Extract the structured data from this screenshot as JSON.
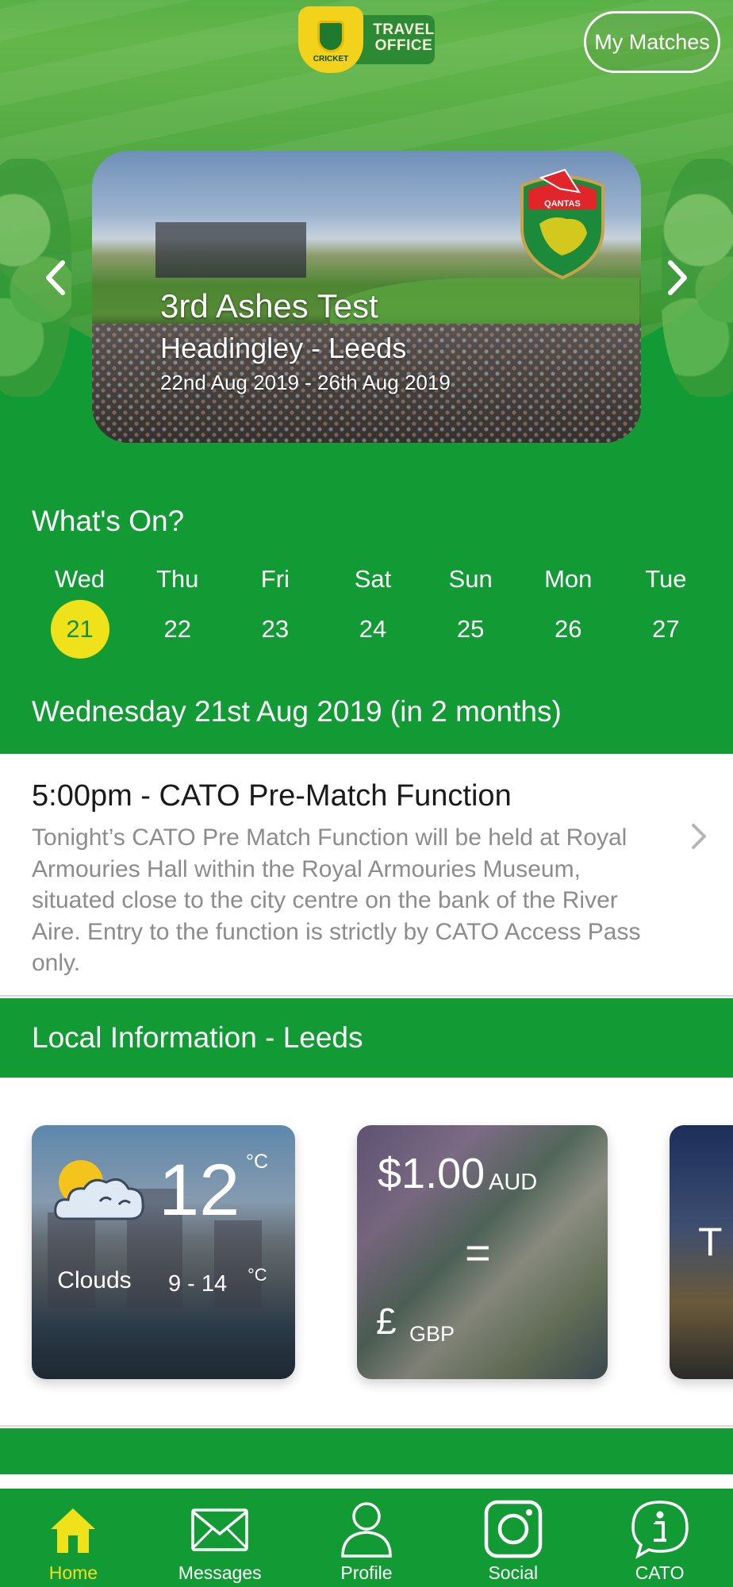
{
  "header": {
    "logo_line1": "TRAVEL",
    "logo_line2": "OFFICE",
    "logo_shield_text": "CRICKET",
    "my_matches_label": "My Matches"
  },
  "featured_match": {
    "title": "3rd Ashes Test",
    "venue": "Headingley - Leeds",
    "dates": "22nd Aug 2019 - 26th Aug 2019",
    "sponsor_badge": "QANTAS"
  },
  "whats_on": {
    "title": "What's On?",
    "days": [
      {
        "name": "Wed",
        "num": "21"
      },
      {
        "name": "Thu",
        "num": "22"
      },
      {
        "name": "Fri",
        "num": "23"
      },
      {
        "name": "Sat",
        "num": "24"
      },
      {
        "name": "Sun",
        "num": "25"
      },
      {
        "name": "Mon",
        "num": "26"
      },
      {
        "name": "Tue",
        "num": "27"
      }
    ],
    "selected_index": 0,
    "date_heading": "Wednesday 21st Aug 2019 (in 2 months)"
  },
  "event": {
    "title": "5:00pm - CATO Pre-Match Function",
    "description": "Tonight’s CATO Pre Match Function will be held at Royal Armouries Hall within the Royal Armouries Museum, situated close to the city centre on the bank of the River Aire.  Entry to the function is strictly by CATO Access Pass only."
  },
  "local_info": {
    "title": "Local Information - Leeds",
    "weather": {
      "temp": "12",
      "unit": "°C",
      "condition": "Clouds",
      "range": "9 - 14",
      "range_unit": "°C",
      "icon": "partly-cloudy-icon"
    },
    "currency": {
      "amount": "$1.00",
      "from_code": "AUD",
      "equals": "=",
      "symbol": "£",
      "to_code": "GBP"
    },
    "third_tile_letter": "T"
  },
  "tabbar": {
    "items": [
      {
        "label": "Home",
        "icon": "home-icon",
        "active": true
      },
      {
        "label": "Messages",
        "icon": "envelope-icon",
        "active": false
      },
      {
        "label": "Profile",
        "icon": "user-icon",
        "active": false
      },
      {
        "label": "Social",
        "icon": "instagram-icon",
        "active": false
      },
      {
        "label": "CATO",
        "icon": "info-bubble-icon",
        "active": false
      }
    ]
  },
  "colors": {
    "brand_green": "#129a34",
    "accent_yellow": "#f0e21a",
    "description_gray": "#8c8c8c"
  }
}
